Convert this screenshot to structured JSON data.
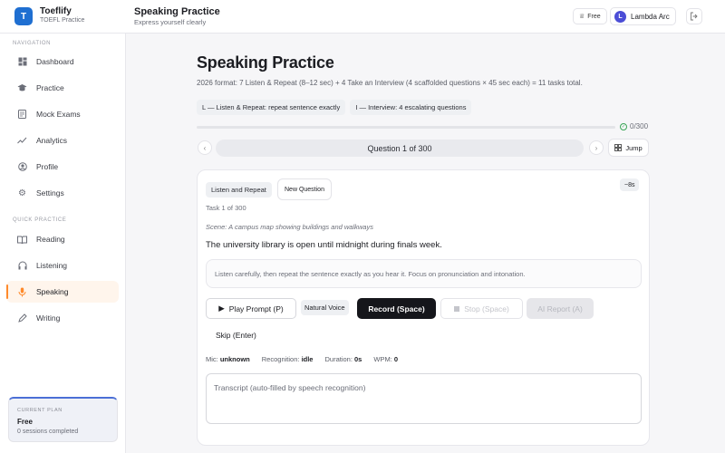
{
  "app": {
    "logo_glyph": "T",
    "name": "Toeflify",
    "subtitle": "TOEFL Practice"
  },
  "header": {
    "title": "Speaking Practice",
    "subtitle": "Express yourself clearly",
    "plan_badge": "Free",
    "user_initial": "L",
    "user_name": "Lambda Arc"
  },
  "sidebar": {
    "nav_heading": "NAVIGATION",
    "nav": [
      {
        "label": "Dashboard",
        "icon": "dashboard-icon"
      },
      {
        "label": "Practice",
        "icon": "graduation-cap-icon"
      },
      {
        "label": "Mock Exams",
        "icon": "document-icon"
      },
      {
        "label": "Analytics",
        "icon": "trend-chart-icon"
      },
      {
        "label": "Profile",
        "icon": "user-icon"
      },
      {
        "label": "Settings",
        "icon": "gear-icon"
      }
    ],
    "quick_heading": "QUICK PRACTICE",
    "quick": [
      {
        "label": "Reading",
        "icon": "book-icon"
      },
      {
        "label": "Listening",
        "icon": "headphones-icon"
      },
      {
        "label": "Speaking",
        "icon": "microphone-icon",
        "active": true
      },
      {
        "label": "Writing",
        "icon": "pencil-icon"
      }
    ],
    "plan": {
      "label": "CURRENT PLAN",
      "name": "Free",
      "sessions": "0 sessions completed"
    }
  },
  "main": {
    "title": "Speaking Practice",
    "format_desc": "2026 format: 7 Listen & Repeat (8–12 sec) + 4 Take an Interview (4 scaffolded questions × 45 sec each) = 11 tasks total.",
    "chips": [
      "L — Listen & Repeat: repeat sentence exactly",
      "I — Interview: 4 escalating questions"
    ],
    "progress": {
      "value": 0,
      "total": 300,
      "label": "0/300"
    },
    "question_label": "Question 1 of 300",
    "jump_label": "Jump"
  },
  "card": {
    "type_label": "Listen and Repeat",
    "new_question_label": "New Question",
    "time_badge": "~8s",
    "task_label": "Task 1 of 300",
    "scene": "Scene: A campus map showing buildings and walkways",
    "sentence": "The university library is open until midnight during finals week.",
    "instruction": "Listen carefully, then repeat the sentence exactly as you hear it. Focus on pronunciation and intonation.",
    "buttons": {
      "play": "Play Prompt (P)",
      "voice": "Natural Voice",
      "record": "Record (Space)",
      "stop": "Stop (Space)",
      "ai": "AI Report (A)",
      "skip": "Skip (Enter)"
    },
    "stats": {
      "mic_label": "Mic:",
      "mic": "unknown",
      "recog_label": "Recognition:",
      "recog": "idle",
      "duration_label": "Duration:",
      "duration": "0s",
      "wpm_label": "WPM:",
      "wpm": "0"
    },
    "transcript_placeholder": "Transcript (auto-filled by speech recognition)"
  },
  "colors": {
    "accent": "#4b4dd6",
    "active_nav": "#ff8a2b",
    "primary_button": "#15161b"
  }
}
